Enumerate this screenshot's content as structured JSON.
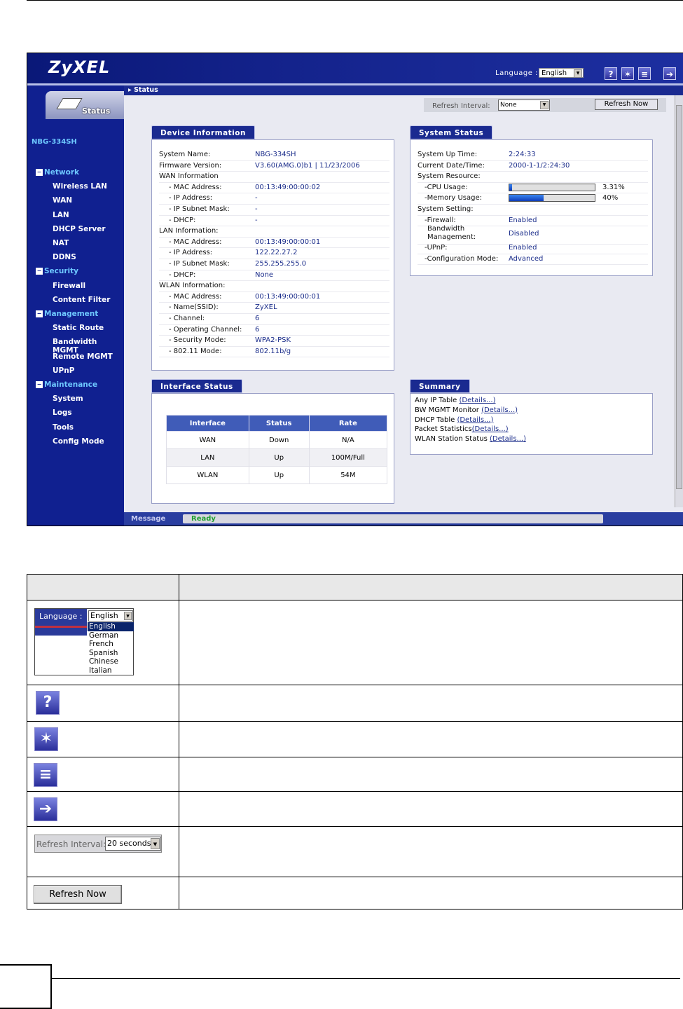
{
  "app": {
    "logo": "ZyXEL",
    "language_label": "Language :",
    "language_value": "English",
    "toolbar_icons": [
      "help-icon",
      "wizard-icon",
      "about-icon",
      "logout-icon"
    ]
  },
  "breadcrumb": "Status",
  "sidebar": {
    "tab_label": "Status",
    "device": "NBG-334SH",
    "groups": [
      {
        "label": "Network",
        "items": [
          "Wireless LAN",
          "WAN",
          "LAN",
          "DHCP Server",
          "NAT",
          "DDNS"
        ]
      },
      {
        "label": "Security",
        "items": [
          "Firewall",
          "Content Filter"
        ]
      },
      {
        "label": "Management",
        "items": [
          "Static Route",
          "Bandwidth MGMT",
          "Remote MGMT",
          "UPnP"
        ]
      },
      {
        "label": "Maintenance",
        "items": [
          "System",
          "Logs",
          "Tools",
          "Config Mode"
        ]
      }
    ]
  },
  "refresh": {
    "label": "Refresh Interval:",
    "value": "None",
    "button": "Refresh Now"
  },
  "device_info": {
    "title": "Device Information",
    "rows": [
      {
        "k": "System Name:",
        "v": "NBG-334SH"
      },
      {
        "k": "Firmware Version:",
        "v": "V3.60(AMG.0)b1 | 11/23/2006"
      },
      {
        "k": "WAN Information",
        "v": ""
      },
      {
        "k": "- MAC Address:",
        "v": "00:13:49:00:00:02"
      },
      {
        "k": "- IP Address:",
        "v": "-"
      },
      {
        "k": "- IP Subnet Mask:",
        "v": "-"
      },
      {
        "k": "- DHCP:",
        "v": "-"
      },
      {
        "k": "LAN Information:",
        "v": ""
      },
      {
        "k": "- MAC Address:",
        "v": "00:13:49:00:00:01"
      },
      {
        "k": "- IP Address:",
        "v": "122.22.27.2"
      },
      {
        "k": "- IP Subnet Mask:",
        "v": "255.255.255.0"
      },
      {
        "k": "- DHCP:",
        "v": "None"
      },
      {
        "k": "WLAN Information:",
        "v": ""
      },
      {
        "k": "- MAC Address:",
        "v": "00:13:49:00:00:01"
      },
      {
        "k": "- Name(SSID):",
        "v": "ZyXEL"
      },
      {
        "k": "- Channel:",
        "v": "6"
      },
      {
        "k": "- Operating Channel:",
        "v": "6"
      },
      {
        "k": "- Security Mode:",
        "v": "WPA2-PSK"
      },
      {
        "k": "- 802.11 Mode:",
        "v": "802.11b/g"
      }
    ]
  },
  "system_status": {
    "title": "System Status",
    "uptime_label": "System Up Time:",
    "uptime": "2:24:33",
    "datetime_label": "Current Date/Time:",
    "datetime": "2000-1-1/2:24:30",
    "resource_label": "System Resource:",
    "cpu_label": "-CPU Usage:",
    "cpu_pct": "3.31%",
    "cpu_fraction": 0.0331,
    "mem_label": "-Memory Usage:",
    "mem_pct": "40%",
    "mem_fraction": 0.4,
    "setting_label": "System Setting:",
    "firewall_label": "-Firewall:",
    "firewall": "Enabled",
    "bw_label_1": "Bandwidth",
    "bw_label_2": "Management:",
    "bw": "Disabled",
    "upnp_label": "-UPnP:",
    "upnp": "Enabled",
    "config_label": "-Configuration Mode:",
    "config": "Advanced"
  },
  "interface_status": {
    "title": "Interface Status",
    "columns": [
      "Interface",
      "Status",
      "Rate"
    ],
    "rows": [
      [
        "WAN",
        "Down",
        "N/A"
      ],
      [
        "LAN",
        "Up",
        "100M/Full"
      ],
      [
        "WLAN",
        "Up",
        "54M"
      ]
    ]
  },
  "summary": {
    "title": "Summary",
    "lines": [
      {
        "text": "Any IP Table ",
        "link": "(Details...)"
      },
      {
        "text": "BW MGMT Monitor ",
        "link": "(Details...)"
      },
      {
        "text": "DHCP Table ",
        "link": "(Details...)"
      },
      {
        "text": "Packet Statistics",
        "link": "(Details...)"
      },
      {
        "text": "WLAN Station Status ",
        "link": "(Details...)"
      }
    ]
  },
  "message": {
    "label": "Message",
    "value": "Ready"
  },
  "desc_table": {
    "language_demo": {
      "label": "Language :",
      "value": "English",
      "options": [
        "English",
        "German",
        "French",
        "Spanish",
        "Chinese",
        "Italian"
      ]
    },
    "refresh_demo": {
      "label": "Refresh Interval:",
      "value": "20 seconds"
    },
    "button_demo": "Refresh Now"
  }
}
